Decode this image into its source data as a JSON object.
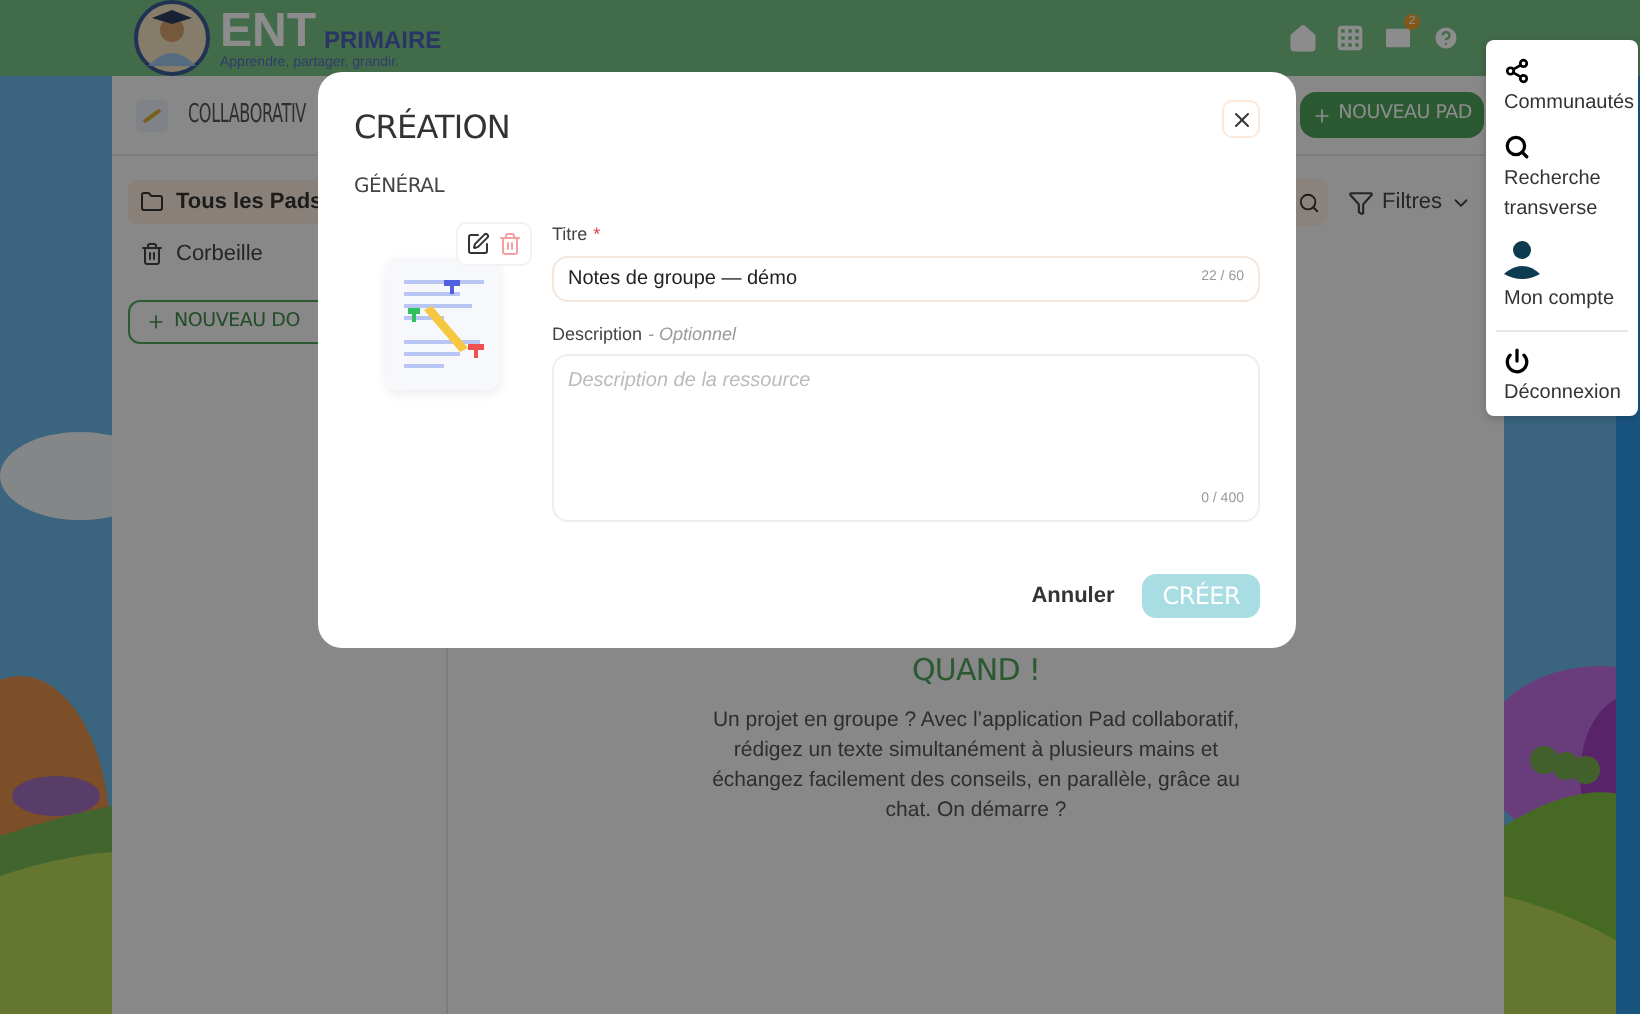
{
  "header": {
    "logo_letters": "ENT",
    "logo_word": "PRIMAIRE",
    "tagline": "Apprendre, partager, grandir.",
    "mail_badge": "2"
  },
  "app": {
    "title": "COLLABORATIV",
    "new_pad_button": "NOUVEAU PAD",
    "sidebar": {
      "items": [
        {
          "label": "Tous les Pads",
          "kind": "folder",
          "selected": true
        },
        {
          "label": "Corbeille",
          "kind": "trash",
          "selected": false
        }
      ],
      "new_folder_button": "NOUVEAU DO"
    },
    "filter_button": "Filtres",
    "empty_state": {
      "heading": "QUAND !",
      "text": "Un projet en groupe ? Avec l’application Pad collaboratif, rédigez un texte simultanément à plusieurs mains et échangez facilement des conseils, en parallèle, grâce au chat. On démarre ?"
    }
  },
  "modal": {
    "title": "CRÉATION",
    "section": "GÉNÉRAL",
    "title_field": {
      "label": "Titre",
      "required_mark": "*",
      "value": "Notes de groupe — démo",
      "counter": "22 / 60"
    },
    "description_field": {
      "label": "Description",
      "optional_hint": "- Optionnel",
      "placeholder": "Description de la ressource",
      "counter": "0 / 400"
    },
    "cancel_button": "Annuler",
    "create_button": {
      "label": "CRÉER",
      "disabled": true
    }
  },
  "user_menu": {
    "items": [
      {
        "label": "Communautés",
        "kind": "share",
        "divider_before": false
      },
      {
        "label": "Recherche transverse",
        "kind": "search",
        "divider_before": false
      },
      {
        "label": "Mon compte",
        "kind": "account",
        "divider_before": false
      },
      {
        "label": "Déconnexion",
        "kind": "logout",
        "divider_before": true
      }
    ]
  }
}
